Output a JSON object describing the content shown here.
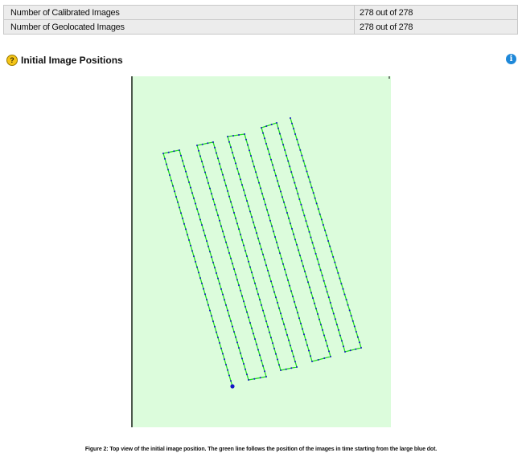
{
  "summary": {
    "rows": [
      {
        "label": "Number of Calibrated Images",
        "value": "278 out of 278"
      },
      {
        "label": "Number of Geolocated Images",
        "value": "278 out of 278"
      }
    ]
  },
  "section": {
    "title": "Initial Image Positions",
    "help_icon": "?",
    "info_icon": "i"
  },
  "figure": {
    "caption": "Figure 2: Top view of the initial image position. The green line follows the position of the images in time starting from the large blue dot.",
    "colors": {
      "background": "#dcfcdc",
      "path": "#22dd22",
      "points": "#1414c8",
      "axis": "#000000"
    }
  }
}
